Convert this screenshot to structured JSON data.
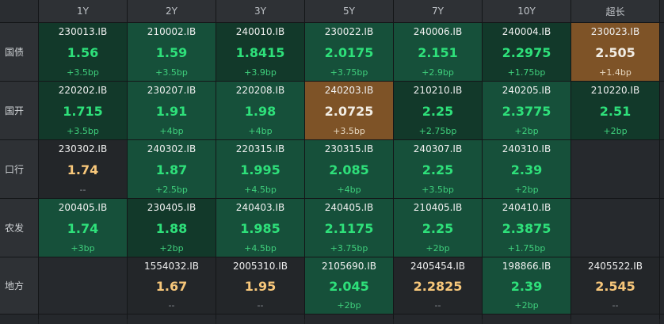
{
  "columns": [
    "1Y",
    "2Y",
    "3Y",
    "5Y",
    "7Y",
    "10Y",
    "超长"
  ],
  "rows": [
    {
      "label": "国债",
      "cells": [
        {
          "code": "230013.IB",
          "yield": "1.56",
          "change": "+3.5bp"
        },
        {
          "code": "210002.IB",
          "yield": "1.59",
          "change": "+3.5bp"
        },
        {
          "code": "240010.IB",
          "yield": "1.8415",
          "change": "+3.9bp"
        },
        {
          "code": "230022.IB",
          "yield": "2.0175",
          "change": "+3.75bp"
        },
        {
          "code": "240006.IB",
          "yield": "2.151",
          "change": "+2.9bp"
        },
        {
          "code": "240004.IB",
          "yield": "2.2975",
          "change": "+1.75bp"
        },
        {
          "code": "230023.IB",
          "yield": "2.505",
          "change": "+1.4bp"
        }
      ]
    },
    {
      "label": "国开",
      "cells": [
        {
          "code": "220202.IB",
          "yield": "1.715",
          "change": "+3.5bp"
        },
        {
          "code": "230207.IB",
          "yield": "1.91",
          "change": "+4bp"
        },
        {
          "code": "220208.IB",
          "yield": "1.98",
          "change": "+4bp"
        },
        {
          "code": "240203.IB",
          "yield": "2.0725",
          "change": "+3.5bp"
        },
        {
          "code": "210210.IB",
          "yield": "2.25",
          "change": "+2.75bp"
        },
        {
          "code": "240205.IB",
          "yield": "2.3775",
          "change": "+2bp"
        },
        {
          "code": "210220.IB",
          "yield": "2.51",
          "change": "+2bp"
        }
      ]
    },
    {
      "label": "口行",
      "cells": [
        {
          "code": "230302.IB",
          "yield": "1.74",
          "change": "--"
        },
        {
          "code": "240302.IB",
          "yield": "1.87",
          "change": "+2.5bp"
        },
        {
          "code": "220315.IB",
          "yield": "1.995",
          "change": "+4.5bp"
        },
        {
          "code": "230315.IB",
          "yield": "2.085",
          "change": "+4bp"
        },
        {
          "code": "240307.IB",
          "yield": "2.25",
          "change": "+3.5bp"
        },
        {
          "code": "240310.IB",
          "yield": "2.39",
          "change": "+2bp"
        },
        null
      ]
    },
    {
      "label": "农发",
      "cells": [
        {
          "code": "200405.IB",
          "yield": "1.74",
          "change": "+3bp"
        },
        {
          "code": "230405.IB",
          "yield": "1.88",
          "change": "+2bp"
        },
        {
          "code": "240403.IB",
          "yield": "1.985",
          "change": "+4.5bp"
        },
        {
          "code": "240405.IB",
          "yield": "2.1175",
          "change": "+3.75bp"
        },
        {
          "code": "210405.IB",
          "yield": "2.25",
          "change": "+2bp"
        },
        {
          "code": "240410.IB",
          "yield": "2.3875",
          "change": "+1.75bp"
        },
        null
      ]
    },
    {
      "label": "地方",
      "cells": [
        null,
        {
          "code": "1554032.IB",
          "yield": "1.67",
          "change": "--"
        },
        {
          "code": "2005310.IB",
          "yield": "1.95",
          "change": "--"
        },
        {
          "code": "2105690.IB",
          "yield": "2.045",
          "change": "+2bp"
        },
        {
          "code": "2405454.IB",
          "yield": "2.2825",
          "change": "--"
        },
        {
          "code": "198866.IB",
          "yield": "2.39",
          "change": "+2bp"
        },
        {
          "code": "2405522.IB",
          "yield": "2.545",
          "change": "--"
        }
      ]
    }
  ],
  "colors": {
    "up_green": "#2ee07a",
    "flat_yellow": "#f7c77a",
    "cell_dark_green": "#12392a",
    "cell_light_green": "#16503a",
    "cell_highlight_orange": "#7e5327",
    "cell_neutral": "#232629"
  }
}
